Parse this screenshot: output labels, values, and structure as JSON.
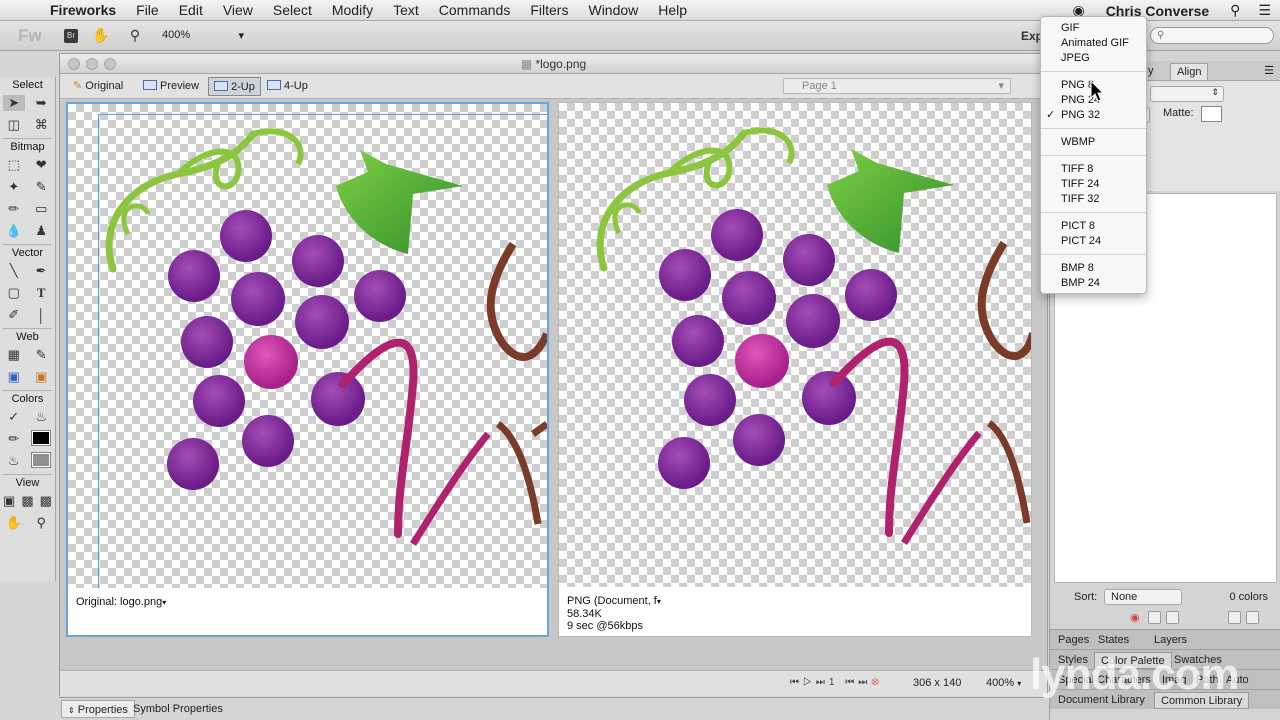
{
  "menubar": {
    "apple_icon": "apple-icon",
    "app_name": "Fireworks",
    "items": [
      "File",
      "Edit",
      "View",
      "Select",
      "Modify",
      "Text",
      "Commands",
      "Filters",
      "Window",
      "Help"
    ],
    "user": "Chris Converse"
  },
  "toolbar": {
    "logo": "Fw",
    "bridge": "Br",
    "zoom": "400%",
    "explorer_label": "Exp"
  },
  "tools": {
    "sections": {
      "select": "Select",
      "bitmap": "Bitmap",
      "vector": "Vector",
      "web": "Web",
      "colors": "Colors",
      "view": "View"
    }
  },
  "document": {
    "title": "*logo.png",
    "tabs": [
      "Original",
      "Preview",
      "2-Up",
      "4-Up"
    ],
    "active_tab": "2-Up",
    "page_select": "Page 1",
    "left_info": "Original: logo.png",
    "right_info": [
      "PNG (Document, f",
      "58.34K",
      "9 sec @56kbps"
    ],
    "frame_number": "1",
    "dimensions": "306 x 140",
    "zoom": "400%"
  },
  "propbar": {
    "tabs": [
      "Properties",
      "Symbol Properties"
    ]
  },
  "right_panel": {
    "top_tab_fragment": "y",
    "top_tab": "Align",
    "matte_label": "Matte:",
    "sort_label": "Sort:",
    "sort_value": "None",
    "color_count": "0 colors",
    "groups": [
      [
        "Pages",
        "States",
        "Layers"
      ],
      [
        "Styles",
        "Color Palette",
        "Swatches"
      ],
      [
        "Special Characters",
        "Imag",
        "Path",
        "Auto"
      ],
      [
        "Document Library",
        "Common Library"
      ]
    ]
  },
  "export_menu": {
    "groups": [
      [
        "GIF",
        "Animated GIF",
        "JPEG"
      ],
      [
        "PNG 8",
        "PNG 24",
        "PNG 32"
      ],
      [
        "WBMP"
      ],
      [
        "TIFF 8",
        "TIFF 24",
        "TIFF 32"
      ],
      [
        "PICT 8",
        "PICT 24"
      ],
      [
        "BMP 8",
        "BMP 24"
      ]
    ],
    "checked": "PNG 32",
    "hovered": "PNG 8"
  },
  "watermark": "lynda.com",
  "colors": {
    "grape_dark": "#6f1f8c",
    "grape_light": "#b8329f",
    "leaf": "#52b53a",
    "vine_magenta": "#b0226d",
    "selection": "#66a7e0"
  }
}
